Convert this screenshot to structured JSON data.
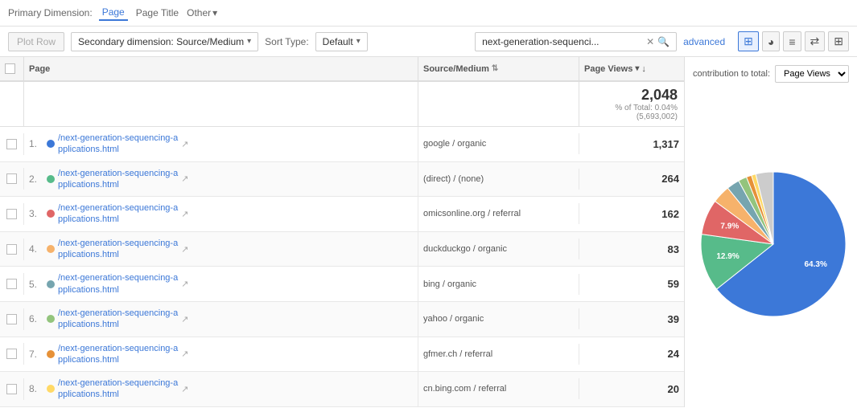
{
  "primaryDimension": {
    "label": "Primary Dimension:",
    "dims": [
      {
        "id": "page",
        "text": "Page",
        "active": true
      },
      {
        "id": "page-title",
        "text": "Page Title",
        "active": false
      },
      {
        "id": "other",
        "text": "Other",
        "active": false,
        "hasArrow": true
      }
    ]
  },
  "toolbar": {
    "plotRowLabel": "Plot Row",
    "secondaryDimension": "Secondary dimension: Source/Medium",
    "sortTypeLabel": "Sort Type:",
    "sortDefault": "Default",
    "searchValue": "next-generation-sequenci...",
    "advancedLabel": "advanced"
  },
  "table": {
    "columns": [
      {
        "id": "checkbox",
        "label": ""
      },
      {
        "id": "page",
        "label": "Page"
      },
      {
        "id": "source",
        "label": "Source/Medium",
        "hasSortIcon": true
      },
      {
        "id": "pageviews-col",
        "label": "Page Views",
        "hasDropdown": true,
        "hasSortDown": true
      },
      {
        "id": "pageviews-pct",
        "label": "Page Views"
      }
    ],
    "summary": {
      "total": "2,048",
      "pct": "% of Total: 0.04%",
      "abs": "(5,693,002)",
      "total2": "2,048",
      "pct2": "% of Total: 0.04%",
      "abs2": "(5,693,002)"
    },
    "rows": [
      {
        "num": "1.",
        "color": "#3c78d8",
        "pageLink": "/next-generation-sequencing-a\npplications.html",
        "source": "google / organic",
        "pageviews": "1,317",
        "pct": "64.31%"
      },
      {
        "num": "2.",
        "color": "#57bb8a",
        "pageLink": "/next-generation-sequencing-a\npplications.html",
        "source": "(direct) / (none)",
        "pageviews": "264",
        "pct": "12.89%"
      },
      {
        "num": "3.",
        "color": "#e06666",
        "pageLink": "/next-generation-sequencing-a\npplications.html",
        "source": "omicsonline.org / referral",
        "pageviews": "162",
        "pct": "7.91%"
      },
      {
        "num": "4.",
        "color": "#f6b26b",
        "pageLink": "/next-generation-sequencing-a\npplications.html",
        "source": "duckduckgo / organic",
        "pageviews": "83",
        "pct": "4.05%"
      },
      {
        "num": "5.",
        "color": "#76a5af",
        "pageLink": "/next-generation-sequencing-a\npplications.html",
        "source": "bing / organic",
        "pageviews": "59",
        "pct": "2.88%"
      },
      {
        "num": "6.",
        "color": "#93c47d",
        "pageLink": "/next-generation-sequencing-a\npplications.html",
        "source": "yahoo / organic",
        "pageviews": "39",
        "pct": "1.90%"
      },
      {
        "num": "7.",
        "color": "#e69138",
        "pageLink": "/next-generation-sequencing-a\npplications.html",
        "source": "gfmer.ch / referral",
        "pageviews": "24",
        "pct": "1.17%"
      },
      {
        "num": "8.",
        "color": "#ffd966",
        "pageLink": "/next-generation-sequencing-a\npplications.html",
        "source": "cn.bing.com / referral",
        "pageviews": "20",
        "pct": "0.98%"
      }
    ]
  },
  "chart": {
    "contributionLabel": "contribution to total:",
    "metricLabel": "Page Views",
    "slices": [
      {
        "pct": 64.31,
        "color": "#3c78d8",
        "label": "64.3%",
        "labelX": 950,
        "labelY": 290
      },
      {
        "pct": 12.89,
        "color": "#57bb8a",
        "label": "12.9%",
        "labelX": 870,
        "labelY": 355
      },
      {
        "pct": 7.91,
        "color": "#e06666",
        "label": "7.9%",
        "labelX": 858,
        "labelY": 252
      },
      {
        "pct": 4.05,
        "color": "#f6b26b",
        "label": "",
        "labelX": 0,
        "labelY": 0
      },
      {
        "pct": 2.88,
        "color": "#76a5af",
        "label": "",
        "labelX": 0,
        "labelY": 0
      },
      {
        "pct": 1.9,
        "color": "#93c47d",
        "label": "",
        "labelX": 0,
        "labelY": 0
      },
      {
        "pct": 1.17,
        "color": "#e69138",
        "label": "",
        "labelX": 0,
        "labelY": 0
      },
      {
        "pct": 0.98,
        "color": "#ffd966",
        "label": "",
        "labelX": 0,
        "labelY": 0
      },
      {
        "pct": 3.91,
        "color": "#cccccc",
        "label": "",
        "labelX": 0,
        "labelY": 0
      }
    ]
  }
}
